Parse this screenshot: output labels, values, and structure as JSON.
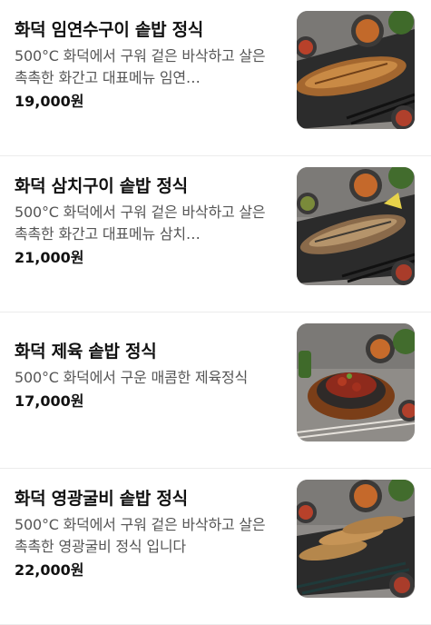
{
  "menu": {
    "items": [
      {
        "name": "화덕 임연수구이 솥밥 정식",
        "description": "500°C 화덕에서 구워 겉은 바삭하고 살은 촉촉한 화간고 대표메뉴 임연…",
        "price": "19,000원",
        "photo_icon": "grilled-fish-set-photo"
      },
      {
        "name": "화덕 삼치구이 솥밥 정식",
        "description": "500°C 화덕에서 구워 겉은 바삭하고 살은 촉촉한 화간고 대표메뉴 삼치…",
        "price": "21,000원",
        "photo_icon": "grilled-fish-set-photo"
      },
      {
        "name": "화덕 제육 솥밥 정식",
        "description": "500°C 화덕에서 구운 매콤한 제육정식",
        "price": "17,000원",
        "photo_icon": "spicy-pork-set-photo"
      },
      {
        "name": "화덕 영광굴비 솥밥 정식",
        "description": "500°C 화덕에서 구워 겉은 바삭하고 살은 촉촉한 영광굴비 정식 입니다",
        "price": "22,000원",
        "photo_icon": "grilled-croaker-set-photo"
      }
    ]
  }
}
